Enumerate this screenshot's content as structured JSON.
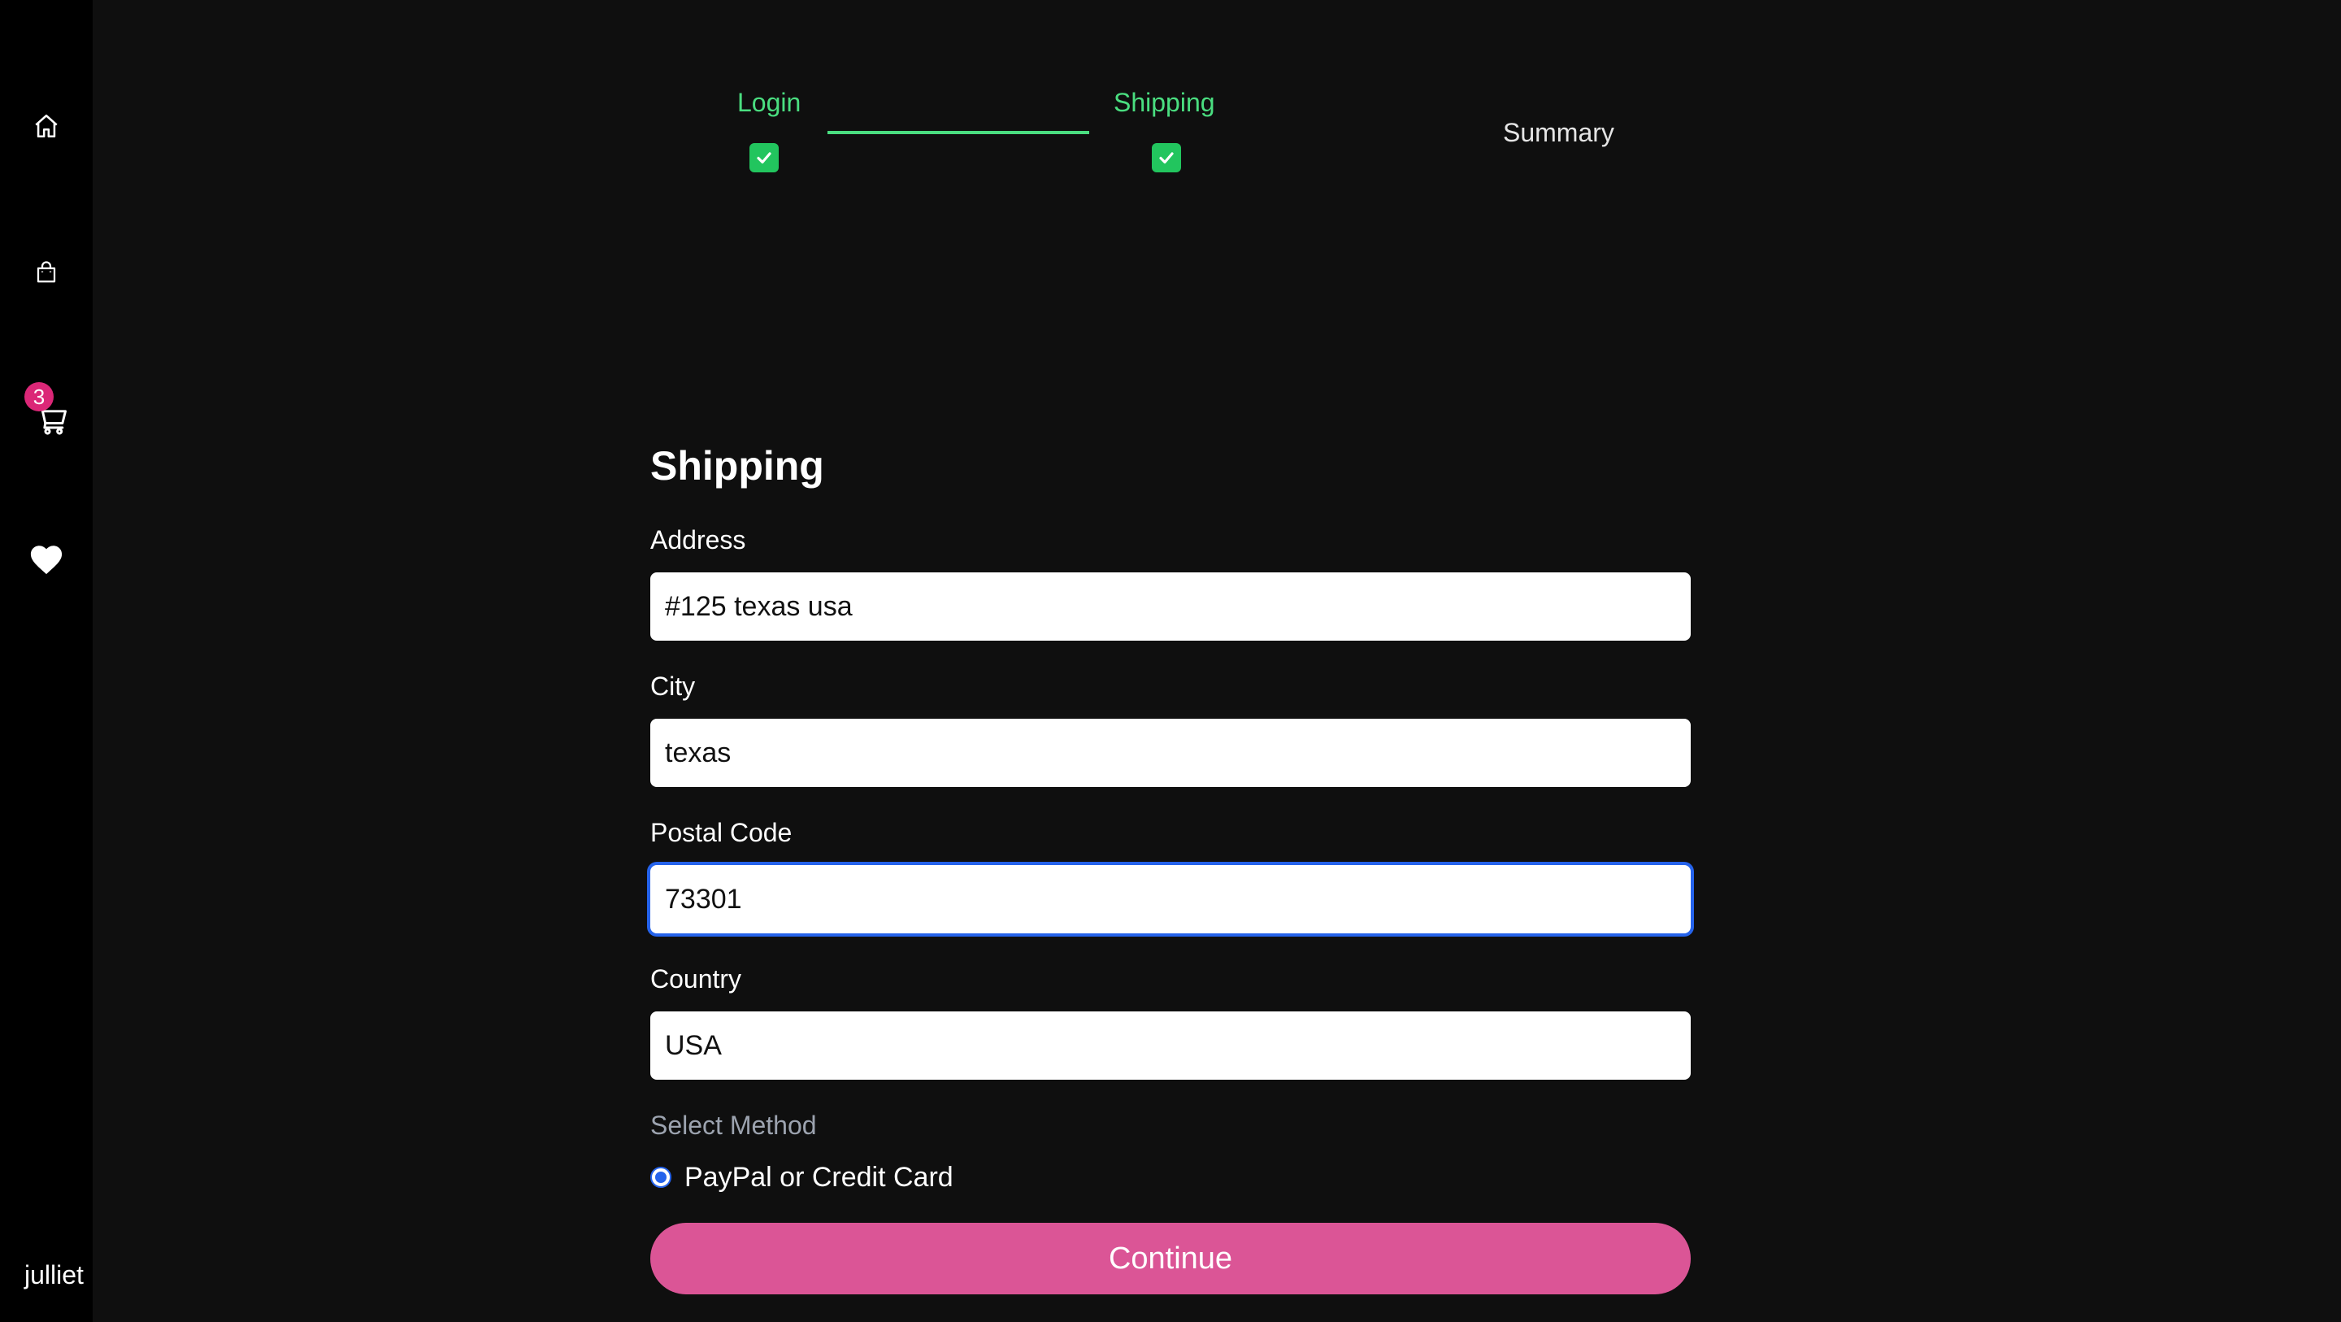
{
  "sidebar": {
    "icons": [
      "home-icon",
      "shopping-bag-icon",
      "cart-icon",
      "heart-icon"
    ],
    "cart_count": "3",
    "username": "julliet"
  },
  "stepper": {
    "steps": [
      {
        "label": "Login",
        "completed": true
      },
      {
        "label": "Shipping",
        "completed": true
      },
      {
        "label": "Summary",
        "completed": false
      }
    ],
    "check_icon": "check-icon"
  },
  "form": {
    "title": "Shipping",
    "fields": {
      "address": {
        "label": "Address",
        "value": "#125 texas usa"
      },
      "city": {
        "label": "City",
        "value": "texas"
      },
      "postal_code": {
        "label": "Postal Code",
        "value": "73301"
      },
      "country": {
        "label": "Country",
        "value": "USA"
      }
    },
    "method": {
      "legend": "Select Method",
      "options": [
        {
          "label": "PayPal or Credit Card",
          "selected": true
        }
      ]
    },
    "submit_label": "Continue"
  },
  "colors": {
    "background": "#0f0f0f",
    "sidebar": "#000000",
    "accent_green": "#4ade80",
    "brand_pink": "#db5596",
    "badge_pink": "#db2777",
    "focus_blue": "#2563eb"
  }
}
